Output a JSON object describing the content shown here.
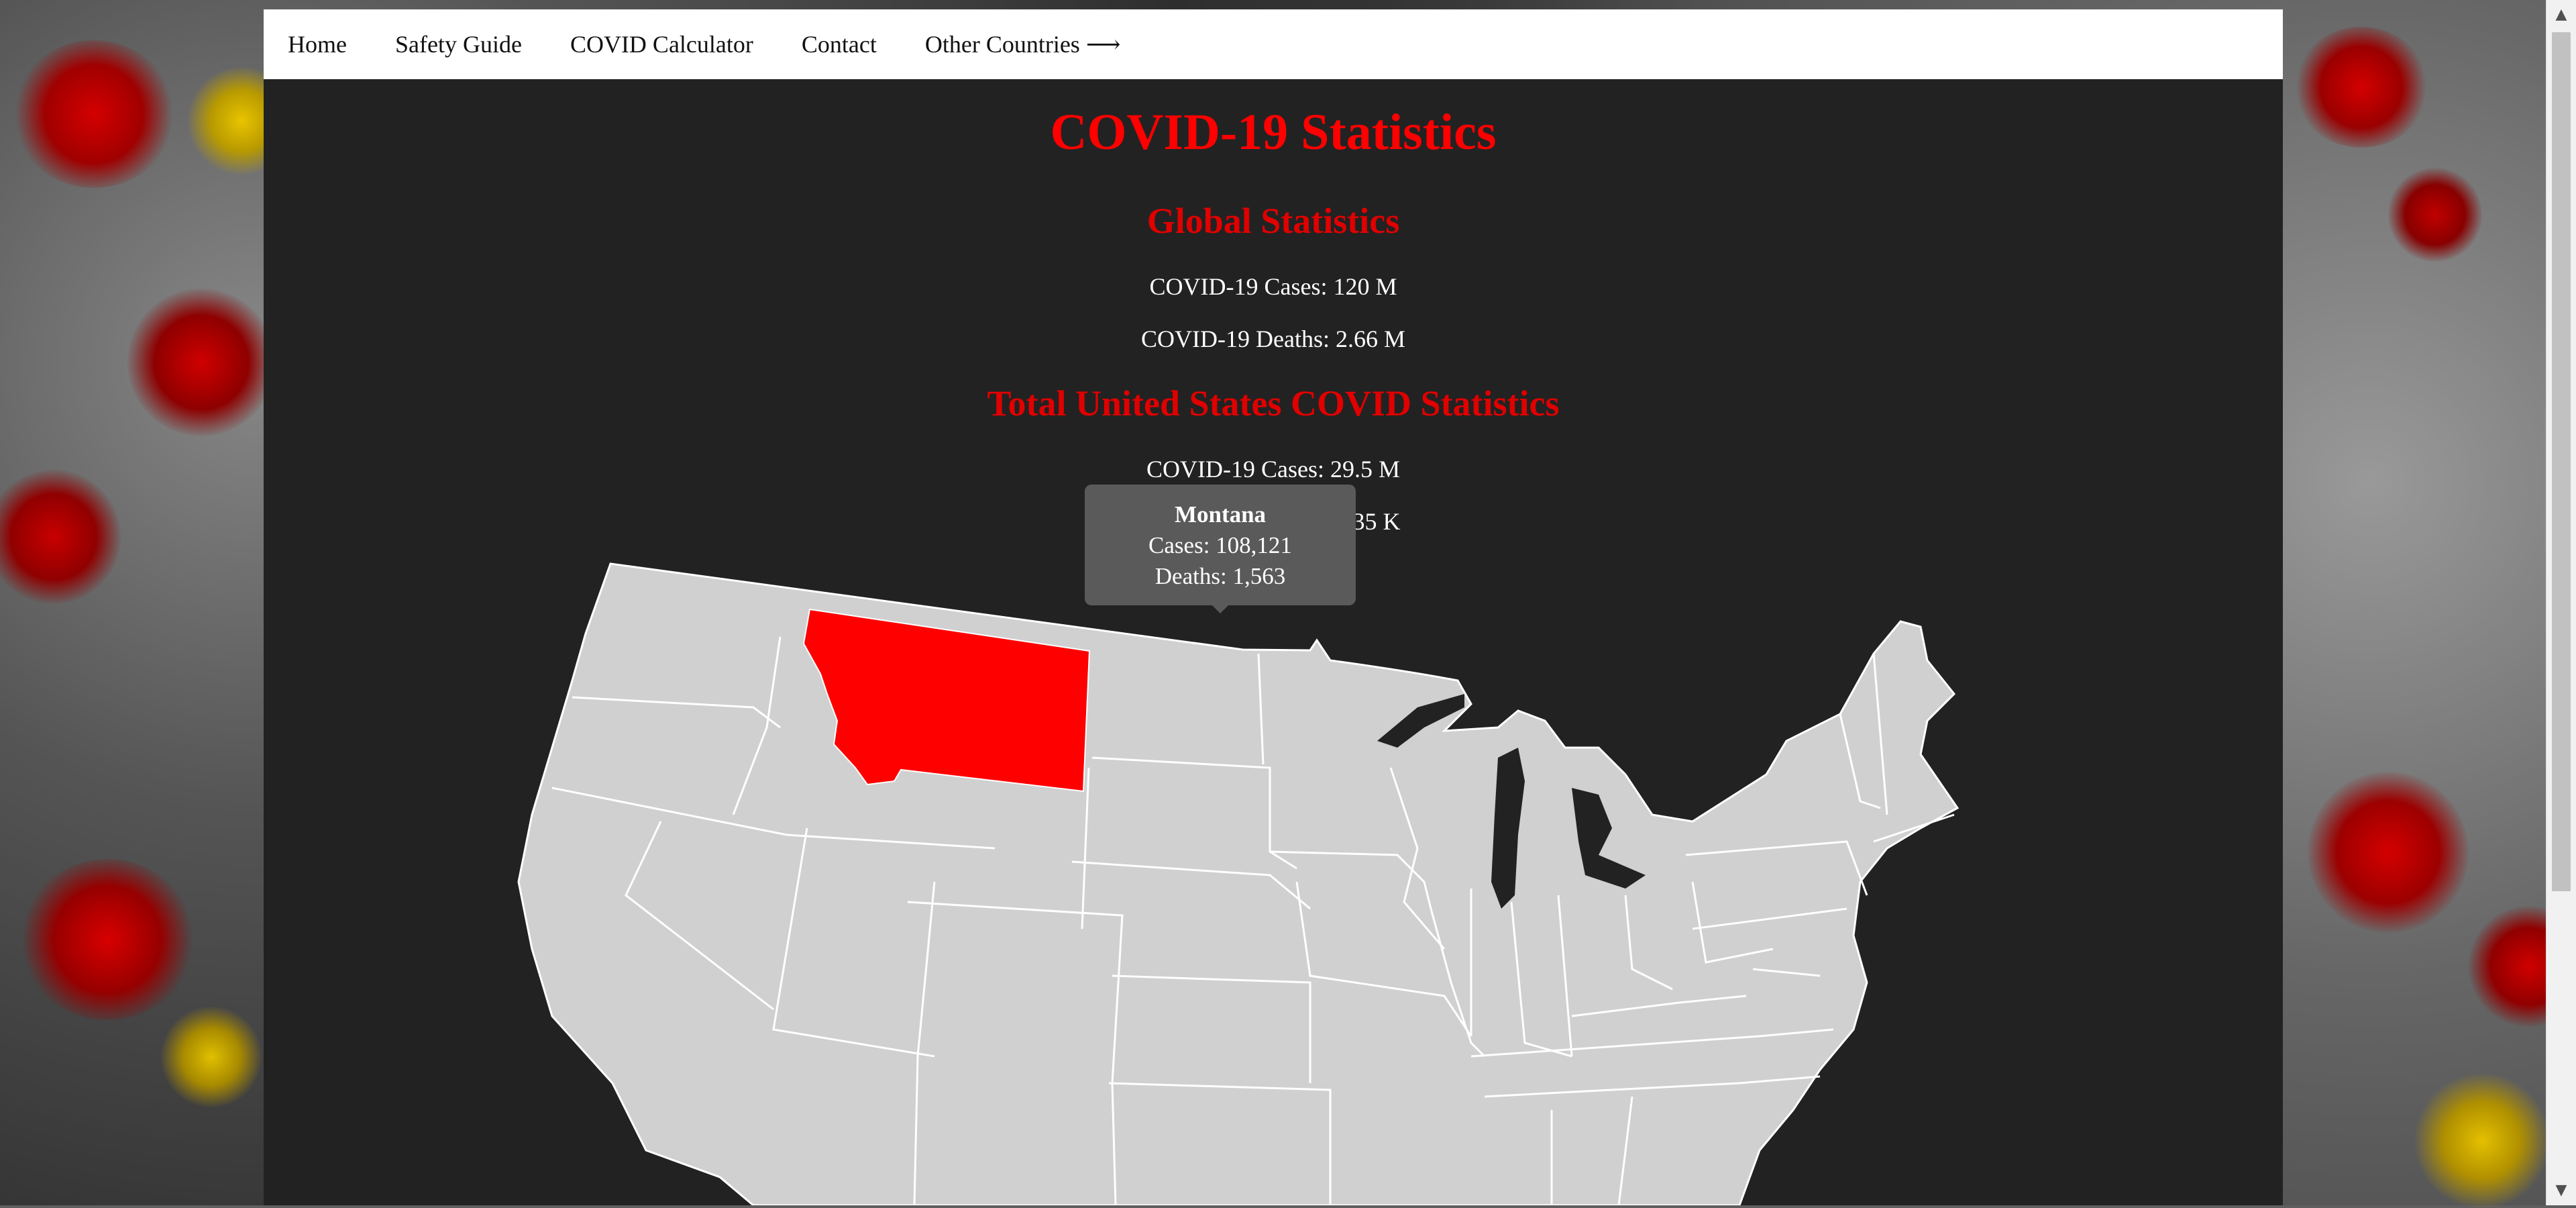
{
  "nav": {
    "items": [
      "Home",
      "Safety Guide",
      "COVID Calculator",
      "Contact",
      "Other Countries ⟶"
    ]
  },
  "page": {
    "title": "COVID-19 Statistics",
    "global": {
      "heading": "Global Statistics",
      "cases": "COVID-19 Cases: 120 M",
      "deaths": "COVID-19 Deaths: 2.66 M"
    },
    "us": {
      "heading": "Total United States COVID Statistics",
      "cases": "COVID-19 Cases: 29.5 M",
      "deaths": "COVID-19 Deaths: 535 K"
    }
  },
  "map": {
    "highlighted_state": "Montana",
    "tooltip": {
      "state": "Montana",
      "cases": "Cases: 108,121",
      "deaths": "Deaths: 1,563"
    },
    "colors": {
      "state_fill": "#d0d0d0",
      "state_border": "#ffffff",
      "highlight_fill": "#ff0000",
      "panel_bg": "#222222",
      "heading_red": "#ff0000"
    }
  }
}
